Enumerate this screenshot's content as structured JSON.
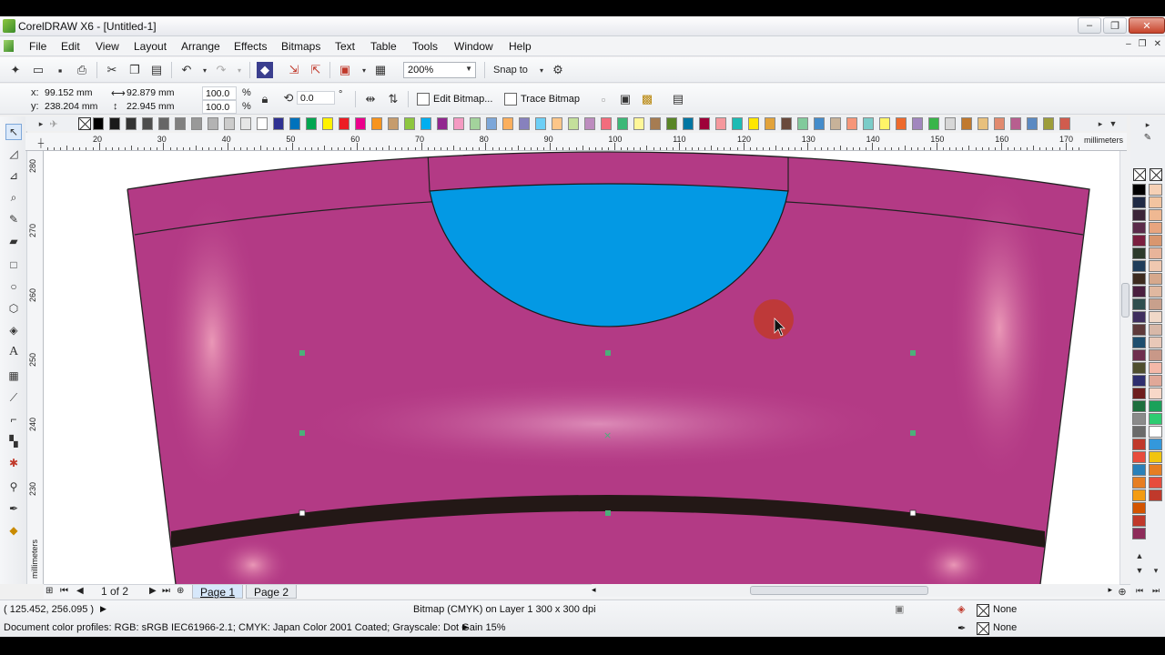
{
  "window": {
    "title": "CorelDRAW X6 - [Untitled-1]",
    "controls": [
      "–",
      "❐",
      "✕"
    ],
    "doc_controls": [
      "–",
      "❐",
      "✕"
    ]
  },
  "menu": [
    "File",
    "Edit",
    "View",
    "Layout",
    "Arrange",
    "Effects",
    "Bitmaps",
    "Text",
    "Table",
    "Tools",
    "Window",
    "Help"
  ],
  "standard_toolbar": {
    "zoom": "200%",
    "snap_to": "Snap to"
  },
  "property_bar": {
    "x_label": "x:",
    "x_value": "99.152 mm",
    "y_label": "y:",
    "y_value": "238.204 mm",
    "width_value": "92.879 mm",
    "height_value": "22.945 mm",
    "scale_w": "100.0",
    "scale_h": "100.0",
    "pct": "%",
    "rotation": "0.0",
    "degree": "°",
    "edit_bitmap": "Edit Bitmap...",
    "trace_bitmap": "Trace Bitmap"
  },
  "ruler": {
    "units": "millimeters",
    "h_labels": [
      "20",
      "30",
      "40",
      "50",
      "60",
      "70",
      "80",
      "90",
      "100",
      "110",
      "120",
      "130",
      "140",
      "150",
      "160",
      "170"
    ],
    "v_labels": [
      "280",
      "270",
      "260",
      "250",
      "240",
      "230"
    ]
  },
  "palette_colors": [
    "#000000",
    "#1a1a1a",
    "#333333",
    "#4d4d4d",
    "#666666",
    "#808080",
    "#999999",
    "#b3b3b3",
    "#cccccc",
    "#e6e6e6",
    "#ffffff",
    "#2e3192",
    "#0072bc",
    "#00a651",
    "#fff200",
    "#ed1c24",
    "#ec008c",
    "#f7941d",
    "#c69c6d",
    "#8dc63f",
    "#00aeef",
    "#92278f",
    "#f49ac2",
    "#a3d39c",
    "#7da7d9",
    "#fbaf5d",
    "#8781bd",
    "#6dcff6",
    "#fdc689",
    "#c4df9b",
    "#bd8cbf",
    "#f26d7d",
    "#3cb878",
    "#fff799",
    "#a67c52",
    "#598527",
    "#0076a3",
    "#9e0039",
    "#f5989d",
    "#1cbbb4",
    "#ffe600",
    "#e2a33b",
    "#6a4a3c",
    "#82ca9c",
    "#448ccb",
    "#c7b299",
    "#f69679",
    "#7accc8",
    "#fff568",
    "#ee6a2d",
    "#a186be",
    "#39b54a",
    "#d7d7d7",
    "#c0792e",
    "#e8c07d",
    "#e18a6f",
    "#b75f8f",
    "#5b8ac2",
    "#9d9d3a",
    "#d05c4e"
  ],
  "right_palette": [
    "#000000",
    "#1f2a44",
    "#3a2438",
    "#5a2b4a",
    "#7a1f3f",
    "#2c3a2c",
    "#203d5a",
    "#3d2b1f",
    "#4a1f3f",
    "#2f4f4f",
    "#3e2e5e",
    "#5e3a3a",
    "#1e4e6e",
    "#6e2e4e",
    "#4e4e2e",
    "#2e2e6e",
    "#6e1e1e",
    "#1e6e3e",
    "#8a8a8a",
    "#6a6a6a",
    "#c0392b",
    "#e74c3c",
    "#2980b9",
    "#e67e22",
    "#f39c12",
    "#d35400",
    "#c0392b",
    "#8e2c5a"
  ],
  "right_palette_light": [
    "#f5d0b5",
    "#f2c4a0",
    "#efb892",
    "#e8a57f",
    "#d9966e",
    "#e8b49a",
    "#f0c8b0",
    "#d6a88c",
    "#e0b8a0",
    "#c8a08c",
    "#f0d8c8",
    "#d8b8a8",
    "#e8c8b8",
    "#c89888",
    "#f4b8a8",
    "#e0a898",
    "#f8d8c8",
    "#1aa15a",
    "#2ecc71",
    "#ffffff",
    "#3498db",
    "#f1c40f",
    "#e67e22",
    "#e74c3c",
    "#c0392b"
  ],
  "page_nav": {
    "page_count": "1 of 2",
    "tabs": [
      "Page 1",
      "Page 2"
    ]
  },
  "status": {
    "cursor": "( 125.452, 256.095 )",
    "selection": "Bitmap (CMYK) on Layer 1 300 x 300 dpi",
    "profiles": "Document color profiles: RGB: sRGB IEC61966-2.1; CMYK: Japan Color 2001 Coated; Grayscale: Dot Gain 15%",
    "fill": "None",
    "outline": "None"
  }
}
